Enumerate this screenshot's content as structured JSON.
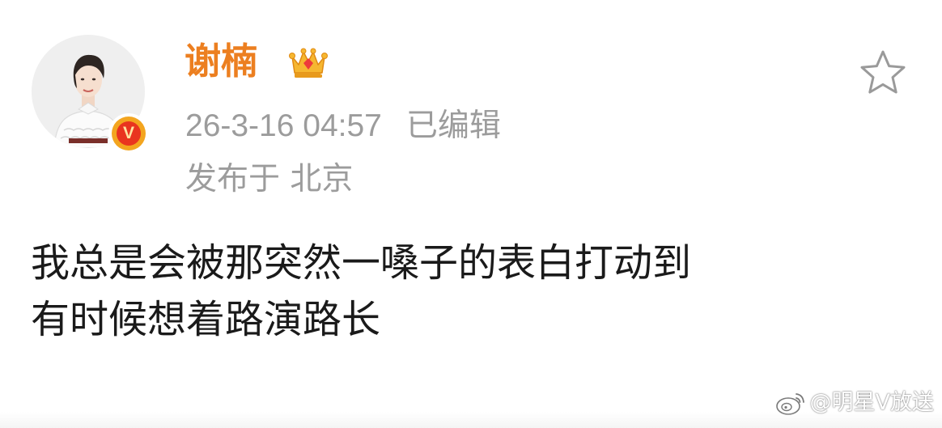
{
  "post": {
    "author_name": "谢楠",
    "timestamp": "26-3-16 04:57",
    "edited_label": "已编辑",
    "location": "发布于 北京",
    "body_lines": [
      "我总是会被那突然一嗓子的表白打动到",
      "有时候想着路演路长"
    ]
  },
  "badges": {
    "verified_letter": "V",
    "crown_icon": "crown-member-icon",
    "verified_icon": "verified-v-icon"
  },
  "actions": {
    "favorite_icon": "star-outline-icon"
  },
  "watermark": {
    "text": "@明星V放送",
    "icon": "weibo-logo-icon"
  },
  "colors": {
    "author_name": "#ec7f20",
    "meta_text": "#9c9c9c",
    "body_text": "#1a1a1a",
    "verified_orange": "#f3a51f",
    "verified_red": "#e9341f"
  }
}
